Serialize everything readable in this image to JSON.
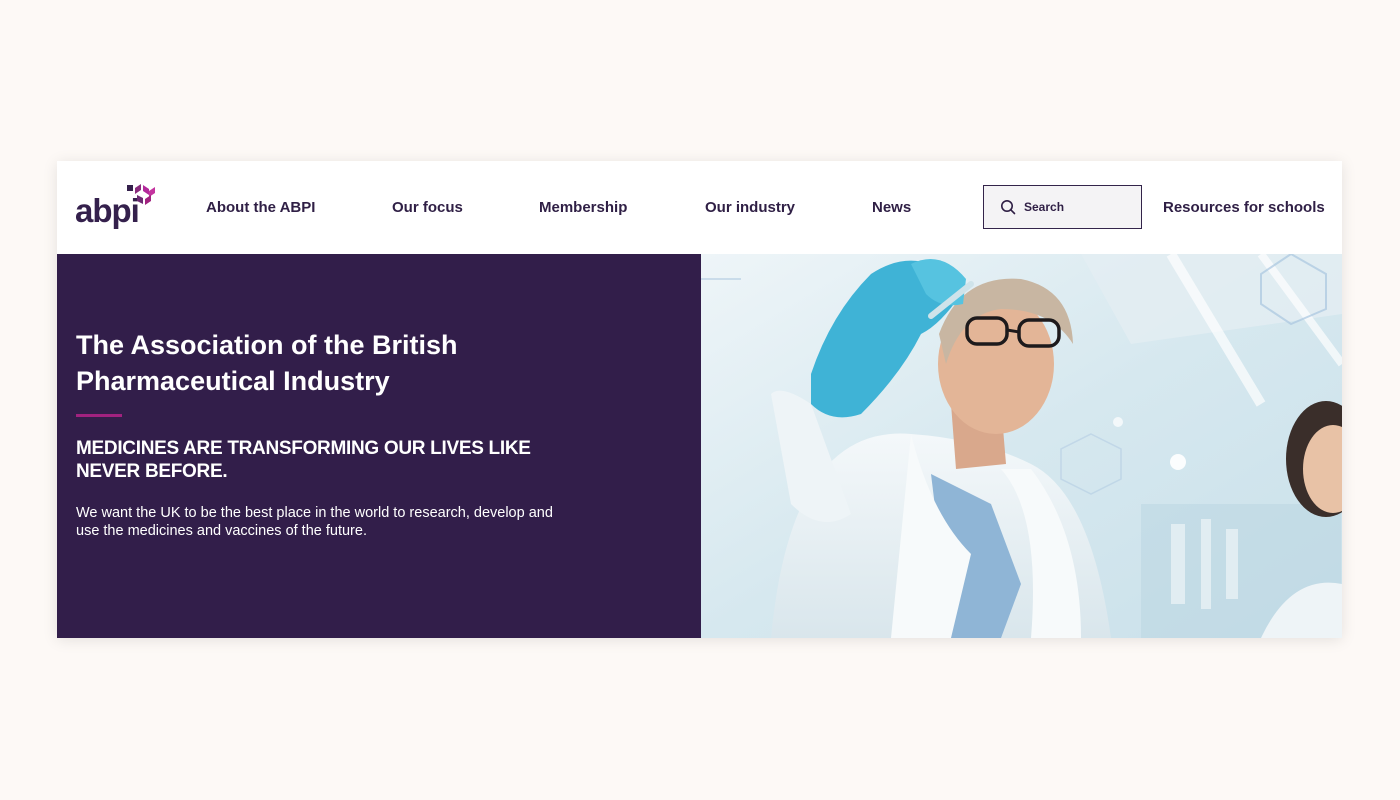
{
  "brand": {
    "name": "abpi",
    "colors": {
      "primary": "#321e4a",
      "accent": "#a1227f",
      "nav_text": "#2f1f45",
      "page_background": "#fdf9f6"
    }
  },
  "nav": {
    "items": [
      {
        "label": "About the ABPI"
      },
      {
        "label": "Our focus"
      },
      {
        "label": "Membership"
      },
      {
        "label": "Our industry"
      },
      {
        "label": "News"
      }
    ],
    "search": {
      "placeholder": "Search",
      "value": "",
      "icon": "search-icon"
    },
    "resources_label": "Resources for schools"
  },
  "hero": {
    "title": "The Association of the British Pharmaceutical Industry",
    "subtitle": "MEDICINES ARE TRANSFORMING OUR LIVES LIKE NEVER BEFORE.",
    "body": "We want the UK to be the best place in the world to research, develop and use the medicines and vaccines of the future."
  }
}
